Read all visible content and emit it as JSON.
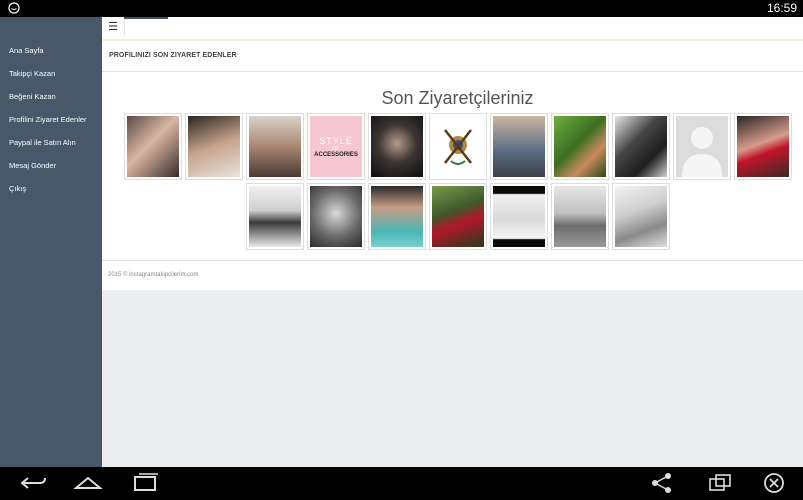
{
  "status_bar": {
    "time": "16:59",
    "notification_icon": "chat-bubble-icon"
  },
  "topbar": {
    "menu_icon": "☰"
  },
  "sidebar": {
    "items": [
      {
        "label": "Ana Sayfa"
      },
      {
        "label": "Takipçi Kazan"
      },
      {
        "label": "Beğeni Kazan"
      },
      {
        "label": "Profilini Ziyaret Edenler"
      },
      {
        "label": "Paypal ile Satın Alın"
      },
      {
        "label": "Mesaj Gönder"
      },
      {
        "label": "Çıkış"
      }
    ]
  },
  "section": {
    "title": "PROFILINIZI SON ZIYARET EDENLER"
  },
  "visitors": {
    "heading": "Son Ziyaretçileriniz",
    "style_tile": {
      "line1": "STYLE",
      "line2": "OF",
      "line3": "ACCESSORIES"
    }
  },
  "footer": {
    "text": "2015 © instagramtakipcilerim.com"
  },
  "colors": {
    "sidebar_bg": "#48576a",
    "page_bg": "#ecedf0",
    "status_bar_bg": "#000000"
  }
}
